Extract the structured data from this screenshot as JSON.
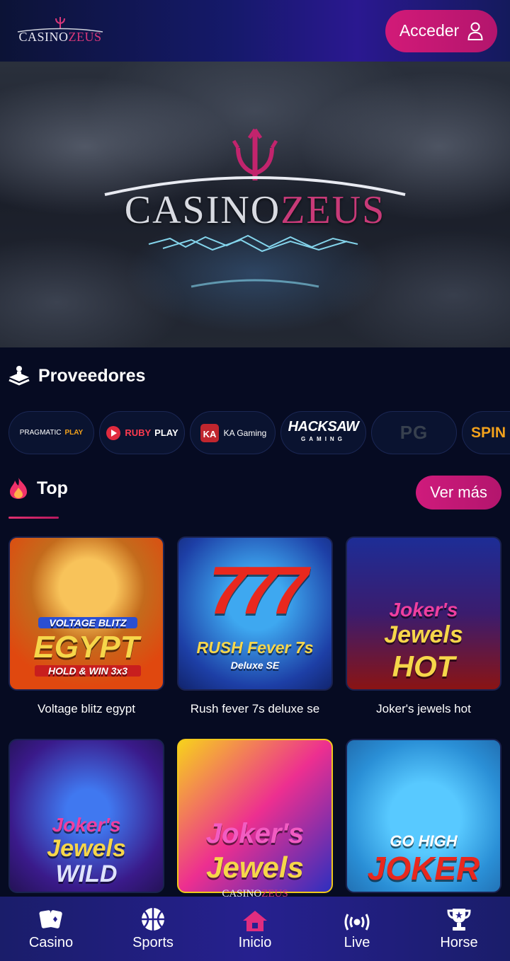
{
  "header": {
    "logo_prefix": "CASINO",
    "logo_suffix": "ZEUS",
    "login_label": "Acceder"
  },
  "hero": {
    "title_prefix": "CASINO",
    "title_suffix": "ZEUS"
  },
  "providers": {
    "title": "Proveedores",
    "items": [
      {
        "name": "PRAGMATIC",
        "suffix": "PLAY"
      },
      {
        "name": "RUBY",
        "suffix": "PLAY"
      },
      {
        "name": "KA Gaming"
      },
      {
        "name": "HACKSAW",
        "suffix": "GAMING"
      },
      {
        "name": "PG"
      },
      {
        "name": "SPIN"
      }
    ]
  },
  "top": {
    "title": "Top",
    "more_label": "Ver más",
    "games": [
      {
        "name": "Voltage blitz egypt",
        "art_top": "VOLTAGE BLITZ",
        "art_main": "EGYPT",
        "art_sub": "HOLD & WIN 3x3"
      },
      {
        "name": "Rush fever 7s deluxe se",
        "art_top": "777",
        "art_main": "RUSH Fever 7s",
        "art_sub": "Deluxe SE"
      },
      {
        "name": "Joker's jewels hot",
        "art_top": "Joker's",
        "art_main": "Jewels",
        "art_sub": "HOT"
      },
      {
        "name": "",
        "art_top": "Joker's",
        "art_main": "Jewels",
        "art_sub": "WILD"
      },
      {
        "name": "",
        "art_top": "Joker's",
        "art_main": "Jewels",
        "art_sub": ""
      },
      {
        "name": "",
        "art_top": "GO HIGH",
        "art_main": "JOKER",
        "art_sub": ""
      }
    ]
  },
  "nav": {
    "logo_prefix": "CASINO",
    "logo_suffix": "ZEUS",
    "items": [
      {
        "label": "Casino",
        "icon": "cards-icon"
      },
      {
        "label": "Sports",
        "icon": "basketball-icon"
      },
      {
        "label": "Inicio",
        "icon": "home-icon"
      },
      {
        "label": "Live",
        "icon": "broadcast-icon"
      },
      {
        "label": "Horse",
        "icon": "trophy-icon"
      }
    ]
  },
  "colors": {
    "accent": "#d21a78",
    "background": "#060b22",
    "header": "#15196a",
    "nav": "#26208f"
  }
}
